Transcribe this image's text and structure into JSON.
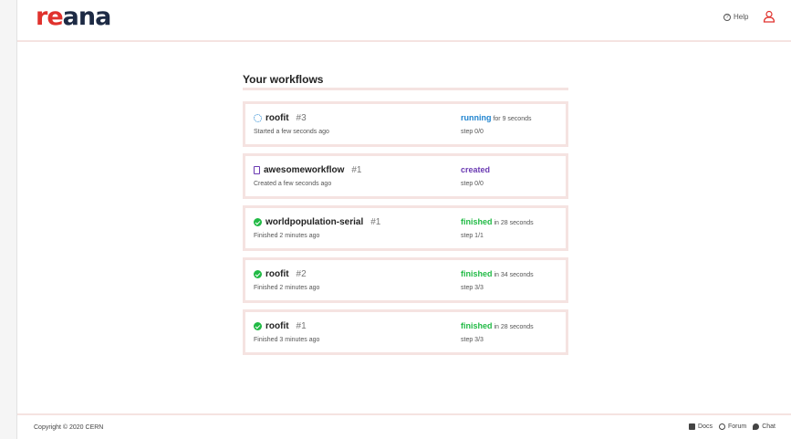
{
  "header": {
    "logo_re": "re",
    "logo_ana": "ana",
    "help_label": "Help"
  },
  "main": {
    "title": "Your workflows",
    "workflows": [
      {
        "name": "roofit",
        "run": "#3",
        "subtitle": "Started a few seconds ago",
        "status": "running",
        "duration": "for 9 seconds",
        "step": "step 0/0",
        "icon": "spinner-icon"
      },
      {
        "name": "awesomeworkflow",
        "run": "#1",
        "subtitle": "Created a few seconds ago",
        "status": "created",
        "duration": "",
        "step": "step 0/0",
        "icon": "file-icon"
      },
      {
        "name": "worldpopulation-serial",
        "run": "#1",
        "subtitle": "Finished 2 minutes ago",
        "status": "finished",
        "duration": "in 28 seconds",
        "step": "step 1/1",
        "icon": "check-circle-icon"
      },
      {
        "name": "roofit",
        "run": "#2",
        "subtitle": "Finished 2 minutes ago",
        "status": "finished",
        "duration": "in 34 seconds",
        "step": "step 3/3",
        "icon": "check-circle-icon"
      },
      {
        "name": "roofit",
        "run": "#1",
        "subtitle": "Finished 3 minutes ago",
        "status": "finished",
        "duration": "in 28 seconds",
        "step": "step 3/3",
        "icon": "check-circle-icon"
      }
    ]
  },
  "footer": {
    "copyright": "Copyright © 2020 CERN",
    "docs": "Docs",
    "forum": "Forum",
    "chat": "Chat"
  },
  "colors": {
    "brand_red": "#e0322d",
    "brand_navy": "#1d2a44",
    "running": "#2185d0",
    "created": "#6a3ab2",
    "finished": "#21ba45",
    "border": "#f5e3e1"
  }
}
